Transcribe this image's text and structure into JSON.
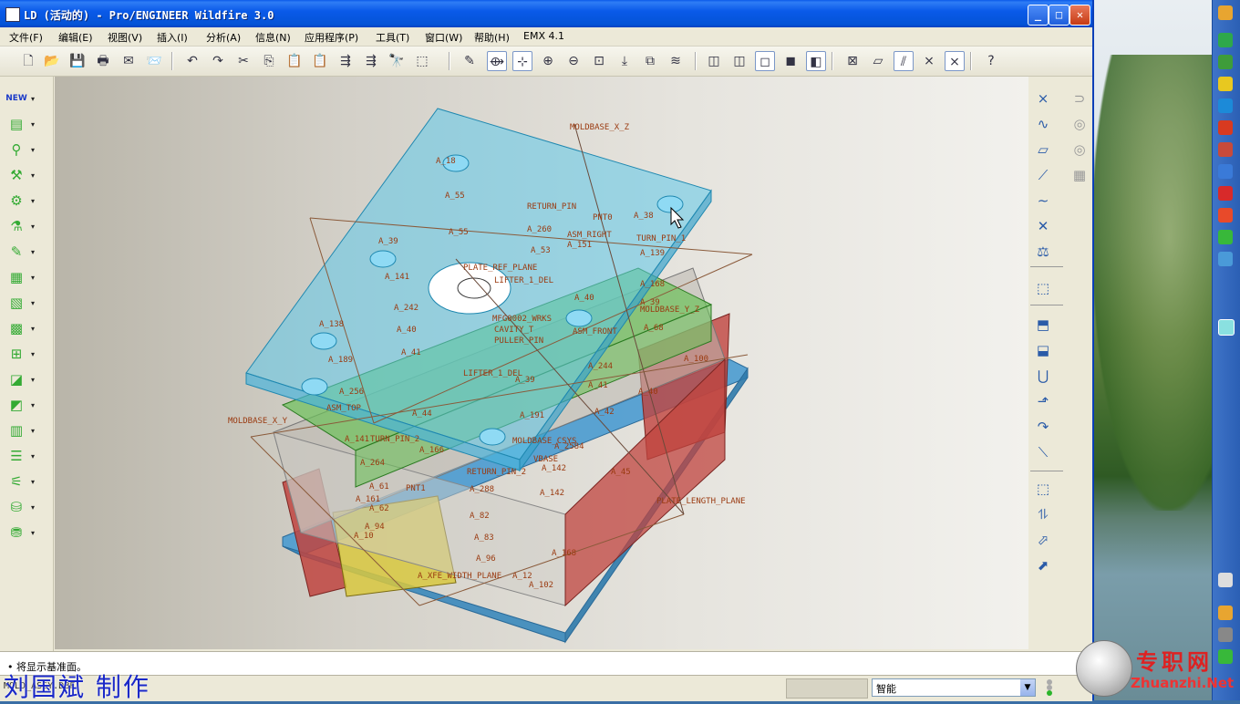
{
  "window": {
    "title": "LD (活动的) - Pro/ENGINEER Wildfire 3.0",
    "controls": {
      "minimize": "_",
      "maximize": "□",
      "close": "✕"
    }
  },
  "menubar": {
    "items": [
      {
        "label": "文件(F)"
      },
      {
        "label": "编辑(E)"
      },
      {
        "label": "视图(V)"
      },
      {
        "label": "插入(I)"
      },
      {
        "label": "分析(A)"
      },
      {
        "label": "信息(N)"
      },
      {
        "label": "应用程序(P)"
      },
      {
        "label": "工具(T)"
      },
      {
        "label": "窗口(W)"
      },
      {
        "label": "帮助(H)"
      },
      {
        "label": "EMX 4.1"
      }
    ]
  },
  "toolbar": {
    "icons": [
      "new-file-icon",
      "open-folder-icon",
      "save-icon",
      "print-icon",
      "email-icon",
      "send-icon",
      "undo-icon",
      "redo-icon",
      "cut-icon",
      "copy-icon",
      "paste-icon",
      "paste-special-icon",
      "regenerate-icon",
      "regen-manager-icon",
      "find-icon",
      "select-box-icon",
      "repaint-icon",
      "orient-icon",
      "spin-center-icon",
      "zoom-in-icon",
      "zoom-out-icon",
      "refit-icon",
      "reorient-icon",
      "saved-views-icon",
      "layers-icon",
      "wireframe-icon",
      "hidden-line-icon",
      "no-hidden-icon",
      "shading-icon",
      "enhanced-realism-icon",
      "close-window-icon",
      "datum-planes-icon",
      "datum-axes-icon",
      "datum-points-icon",
      "coordinate-systems-icon",
      "context-help-icon"
    ]
  },
  "left_toolbar": {
    "items": [
      {
        "name": "new-moldbase-icon",
        "glyph": "NEW"
      },
      {
        "name": "plate-icon",
        "glyph": "▤"
      },
      {
        "name": "guide-pin-icon",
        "glyph": "⚲"
      },
      {
        "name": "screw-icon",
        "glyph": "⚒"
      },
      {
        "name": "ejector-pin-icon",
        "glyph": "⚙"
      },
      {
        "name": "sprue-bushing-icon",
        "glyph": "⚗"
      },
      {
        "name": "locating-ring-icon",
        "glyph": "✎"
      },
      {
        "name": "slider-icon",
        "glyph": "▦"
      },
      {
        "name": "lifter-icon",
        "glyph": "▧"
      },
      {
        "name": "cooling-icon",
        "glyph": "▩"
      },
      {
        "name": "insert-icon",
        "glyph": "⊞"
      },
      {
        "name": "trim-icon",
        "glyph": "◪"
      },
      {
        "name": "pocket-icon",
        "glyph": "◩"
      },
      {
        "name": "component-icon",
        "glyph": "▥"
      },
      {
        "name": "bom-icon",
        "glyph": "☰"
      },
      {
        "name": "drawing-icon",
        "glyph": "⚟"
      },
      {
        "name": "simulation-icon",
        "glyph": "⛁"
      },
      {
        "name": "check-icon",
        "glyph": "⛃"
      }
    ]
  },
  "right_toolbar": {
    "items": [
      "datum-point-tool-icon",
      "datum-curve-tool-icon",
      "datum-plane-tool-icon",
      "datum-axis-tool-icon",
      "sketch-curve-icon",
      "coordinate-system-tool-icon",
      "analysis-feature-icon",
      "sketch-tool-icon",
      "extrude-icon",
      "revolve-icon",
      "sweep-icon",
      "blend-icon",
      "round-icon",
      "chamfer-icon",
      "shell-icon",
      "mirror-icon",
      "rib-icon",
      "draft-icon"
    ],
    "dim_items": [
      "merge-icon",
      "trim-tool-icon",
      "pattern-icon",
      "offset-icon"
    ]
  },
  "viewport": {
    "labels": [
      "MOLDBASE_X_Z",
      "A_18",
      "A_55",
      "RETURN_PIN",
      "PNT0",
      "A_38",
      "A_260",
      "ASM_RIGHT",
      "TURN_PIN_1",
      "A_151",
      "A_53",
      "A_139",
      "A_39",
      "A_55",
      "A_141",
      "PLATE_REF_PLANE",
      "LIFTER_1_DEL",
      "A_168",
      "A_40",
      "A_39",
      "MOLDBASE_Y_Z",
      "A_242",
      "MFG0002_WRKS",
      "A_68",
      "A_40",
      "CAVITY_T",
      "ASM_FRONT",
      "A_138",
      "PULLER_PIN",
      "A_41",
      "A_189",
      "A_244",
      "A_100",
      "LIFTER_1_DEL",
      "A_39",
      "A_41",
      "A_40",
      "A_256",
      "A_42",
      "ASM_TOP",
      "A_44",
      "A_191",
      "MOLDBASE_X_Y",
      "A_141",
      "TURN_PIN_2",
      "MOLDBASE_CSYS",
      "A_2584",
      "A_166",
      "VBASE",
      "A_264",
      "RETURN_PIN_2",
      "A_142",
      "A_45",
      "A_61",
      "PNT1",
      "A_288",
      "A_142",
      "A_161",
      "A_62",
      "A_82",
      "PLATE_LENGTH_PLANE",
      "A_94",
      "A_83",
      "A_10",
      "A_96",
      "A_168",
      "A_XFE_WIDTH_PLANE",
      "A_12",
      "A_102"
    ]
  },
  "message": {
    "text": "• 将显示基准面。"
  },
  "status": {
    "path": "MOLD_ASSY.DBF",
    "filter": "智能",
    "filter_arrow": "▼"
  },
  "overlay": {
    "author": "刘国斌  制作"
  },
  "watermark": {
    "cn": "专职网",
    "site": "Zhuanzhi.Net"
  },
  "colors": {
    "title_blue": "#0a5ae9",
    "plate_cyan": "#5ec8ea",
    "plate_green": "#6cc05a",
    "plate_red": "#c0443f",
    "plate_yellow": "#d8c840",
    "plate_base_blue": "#4a9bd0",
    "label_text": "#9a3a10",
    "label_bg": "#e8c8b0"
  }
}
